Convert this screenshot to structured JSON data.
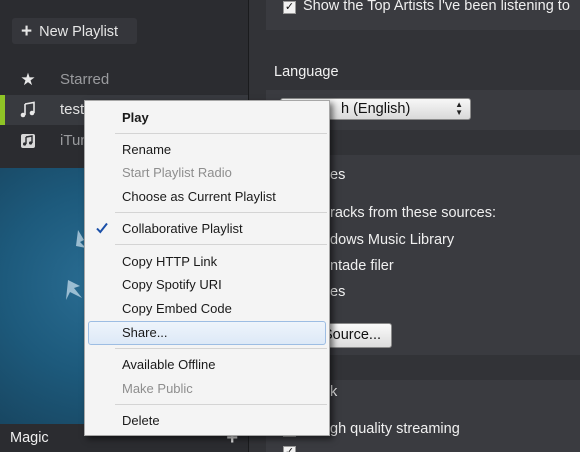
{
  "sidebar": {
    "new_playlist_label": "New Playlist",
    "items": [
      {
        "label": "Starred",
        "icon": "star-icon"
      },
      {
        "label": "test",
        "icon": "playlist-icon",
        "selected": true
      },
      {
        "label": "iTun",
        "icon": "itunes-icon"
      }
    ],
    "bottom_label": "Magic",
    "accent_color": "#8fc426"
  },
  "settings": {
    "top_checkbox_label": "Show the Top Artists I've been listening to",
    "language_heading": "Language",
    "language_value": "h (English)",
    "local_files_heading": "es",
    "sources_text": "racks from these sources:",
    "sources": [
      "dows Music Library",
      "ntade filer",
      "es"
    ],
    "add_source_label": "Source...",
    "streaming_heading": "k",
    "streaming_label": "gh quality streaming"
  },
  "context_menu": {
    "play": "Play",
    "rename": "Rename",
    "start_radio": "Start Playlist Radio",
    "choose_current": "Choose as Current Playlist",
    "collaborative": "Collaborative Playlist",
    "copy_http": "Copy HTTP Link",
    "copy_uri": "Copy Spotify URI",
    "copy_embed": "Copy Embed Code",
    "share": "Share...",
    "available_offline": "Available Offline",
    "make_public": "Make Public",
    "delete": "Delete"
  }
}
